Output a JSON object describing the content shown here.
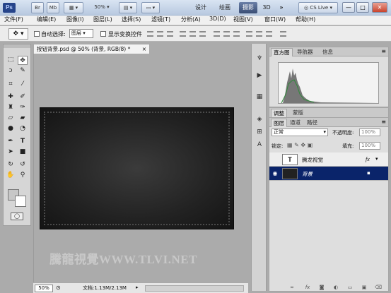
{
  "titlebar": {
    "app_logo": "Ps",
    "bridge_btn": "Br",
    "minibridge_btn": "Mb",
    "zoom_value": "50%",
    "workspaces": [
      "设计",
      "绘画",
      "摄影",
      "3D"
    ],
    "active_workspace": "摄影",
    "more_label": "»",
    "cslive_label": "CS Live",
    "minimize_label": "—",
    "maximize_label": "□",
    "close_label": "✕"
  },
  "menubar": {
    "items": [
      "文件(F)",
      "编辑(E)",
      "图像(I)",
      "图层(L)",
      "选择(S)",
      "滤镜(T)",
      "分析(A)",
      "3D(D)",
      "视图(V)",
      "窗口(W)",
      "帮助(H)"
    ]
  },
  "optionsbar": {
    "auto_select_label": "自动选择:",
    "auto_select_target": "图层",
    "show_transform_label": "显示变换控件"
  },
  "toolbox": {
    "tools": [
      "move",
      "marquee",
      "lasso",
      "quick-select",
      "crop",
      "eyedropper",
      "healing",
      "brush",
      "stamp",
      "history-brush",
      "eraser",
      "gradient",
      "blur",
      "dodge",
      "pen",
      "type",
      "path-select",
      "shape",
      "3d-rotate",
      "3d-orbit",
      "hand",
      "zoom"
    ],
    "active_tool": "move"
  },
  "document": {
    "tab_title": "按钮背景.psd @ 50% (背景, RGB/8) *",
    "close_label": "×",
    "watermark": "騰龍視覺WWW.TLVI.NET",
    "zoom": "50%",
    "doc_info": "文档:1.13M/2.13M"
  },
  "panels": {
    "histogram_tabs": [
      "直方图",
      "导航器",
      "信息"
    ],
    "adjust_tabs": [
      "调整",
      "蒙版"
    ],
    "layers_tabs": [
      "图层",
      "通道",
      "路径"
    ],
    "blend_mode": "正常",
    "opacity_label": "不透明度:",
    "opacity_value": "100%",
    "lock_label": "锁定:",
    "fill_label": "填充:",
    "fill_value": "100%",
    "layers": [
      {
        "name": "腾龙视觉",
        "type": "text",
        "thumb": "T",
        "fx": "fx",
        "selected": false
      },
      {
        "name": "背景",
        "type": "image",
        "thumb": "",
        "fx": "",
        "selected": true
      }
    ]
  },
  "colors": {
    "selection_blue": "#0a246a",
    "artwork_dark": "#222222",
    "canvas_gray": "#ababab"
  }
}
